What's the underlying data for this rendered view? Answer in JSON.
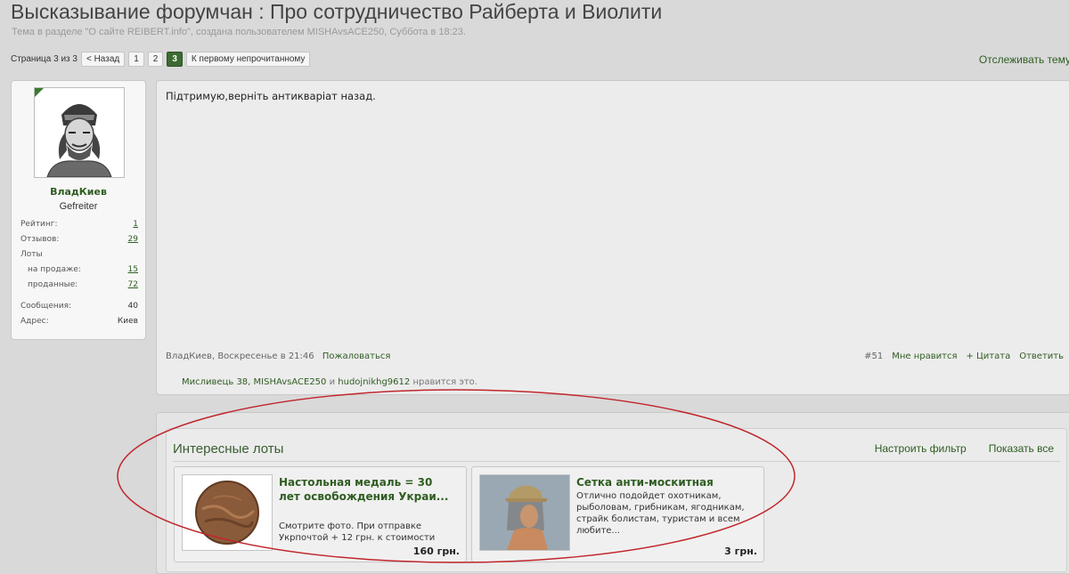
{
  "thread": {
    "title": "Высказывание форумчан : Про сотрудничество Райберта и Виолити",
    "subtitle": "Тема в разделе \"О сайте REIBERT.info\", создана пользователем MISHAvsACE250, Суббота в 18:23."
  },
  "pager": {
    "label": "Страница 3 из 3",
    "prev": "< Назад",
    "pages": [
      "1",
      "2",
      "3"
    ],
    "current": "3",
    "first_unread": "К первому непрочитанному"
  },
  "follow_label": "Отслеживать тему",
  "user": {
    "name": "ВладКиев",
    "rank": "Gefreiter",
    "stats": [
      {
        "label": "Рейтинг:",
        "value": "1"
      },
      {
        "label": "Отзывов:",
        "value": "29"
      },
      {
        "label": "Лоты",
        "value": ""
      },
      {
        "label": "на продаже:",
        "value": "15"
      },
      {
        "label": "проданные:",
        "value": "72"
      },
      {
        "label": "Сообщения:",
        "value": "40"
      },
      {
        "label": "Адрес:",
        "value": "Киев"
      }
    ]
  },
  "post": {
    "text": "Підтримую,верніть антикваріат назад.",
    "author": "ВладКиев",
    "date": "Воскресенье в 21:46",
    "report": "Пожаловаться",
    "number": "#51",
    "like": "Мне нравится",
    "quote": "+ Цитата",
    "reply": "Ответить",
    "likes": {
      "users": "Мисливець 38, MISHAvsACE250",
      "and": "и",
      "last": "hudojnikhg9612",
      "suffix": "нравится это."
    }
  },
  "lots": {
    "title": "Интересные лоты",
    "filter": "Настроить фильтр",
    "show_all": "Показать все",
    "items": [
      {
        "title": "Настольная медаль = 30 лет освобождения Украи...",
        "desc": "Смотрите фото. При отправке Укрпочтой + 12 грн. к стоимости",
        "price": "160 грн."
      },
      {
        "title": "Сетка анти-москитная",
        "desc": "Отлично подойдет охотникам, рыболовам, грибникам, ягодникам, страйк болистам, туристам и всем любите...",
        "price": "3 грн."
      }
    ]
  },
  "colors": {
    "link": "#2f5d22",
    "accent": "#3b6a32",
    "annotation": "#c0262b"
  }
}
